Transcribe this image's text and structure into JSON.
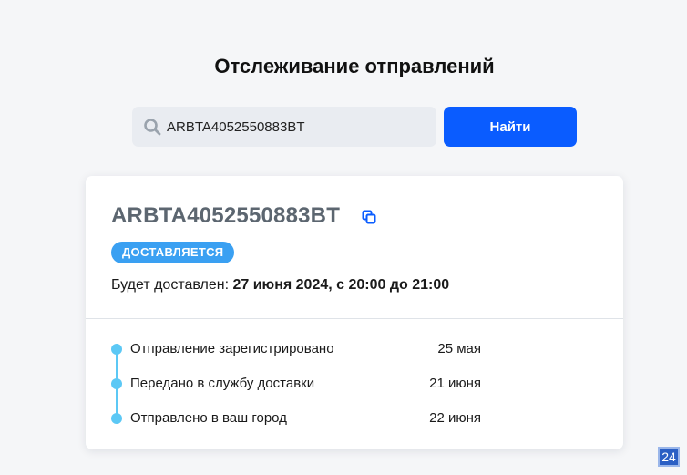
{
  "header": {
    "title": "Отслеживание отправлений"
  },
  "search": {
    "value": "ARBTA4052550883BT",
    "button_label": "Найти",
    "icon": "search-icon"
  },
  "shipment": {
    "tracking_number": "ARBTA4052550883BT",
    "copy_icon": "copy-icon",
    "status": "ДОСТАВЛЯЕТСЯ",
    "delivery_prefix": "Будет доставлен: ",
    "delivery_date": "27 июня 2024, с 20:00 до 21:00",
    "events": [
      {
        "label": "Отправление зарегистрировано",
        "date": "25 мая"
      },
      {
        "label": "Передано в службу доставки",
        "date": "21 июня"
      },
      {
        "label": "Отправлено в ваш город",
        "date": "22 июня"
      }
    ]
  },
  "corner_badge": {
    "text": "24"
  },
  "colors": {
    "accent": "#0a5cff",
    "status_badge": "#3aa0f2",
    "timeline": "#5cc8f5",
    "background": "#f5f6f8"
  }
}
